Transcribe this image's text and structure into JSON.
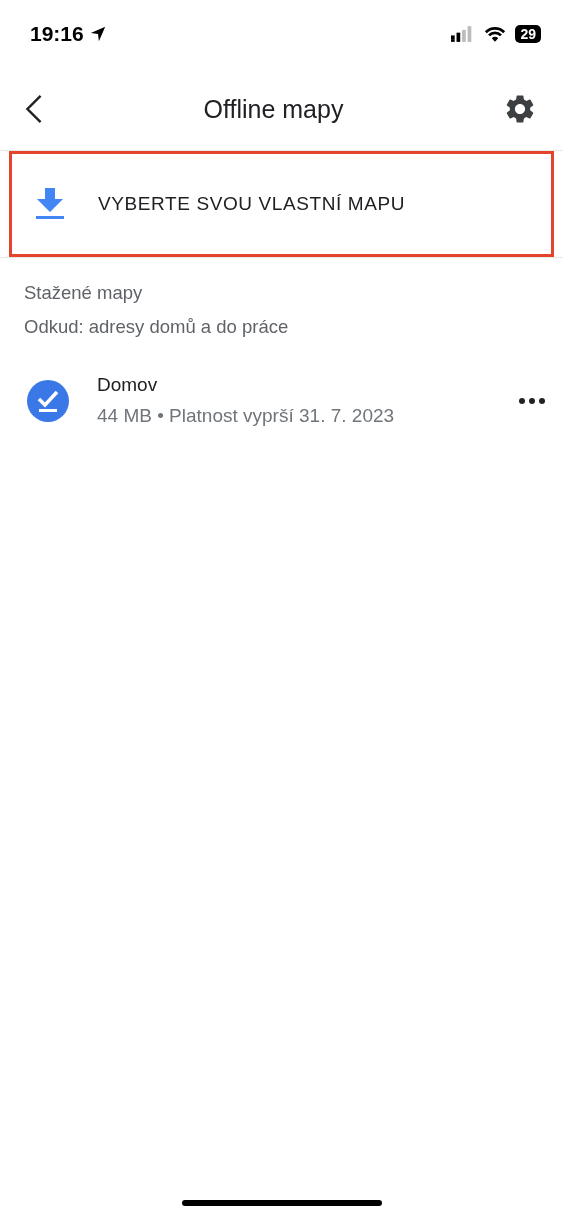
{
  "status_bar": {
    "time": "19:16",
    "battery": "29"
  },
  "header": {
    "title": "Offline mapy"
  },
  "select_map_button": {
    "label": "VYBERTE SVOU VLASTNÍ MAPU",
    "highlighted": true
  },
  "section": {
    "title": "Stažené mapy",
    "subtitle": "Odkud: adresy domů a do práce"
  },
  "maps": [
    {
      "name": "Domov",
      "details": "44 MB • Platnost vyprší 31. 7. 2023"
    }
  ]
}
